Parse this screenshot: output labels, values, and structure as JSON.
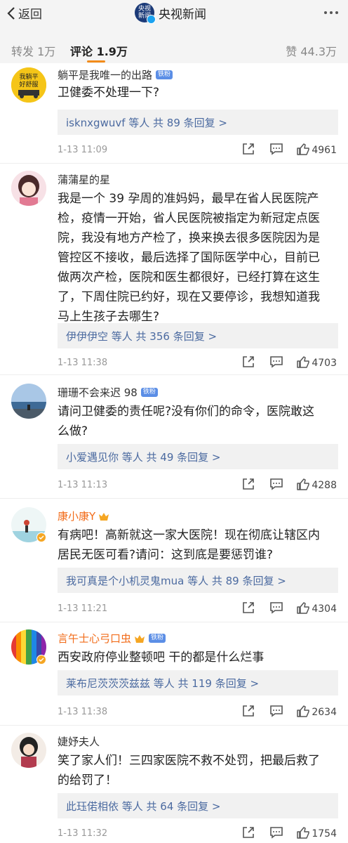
{
  "nav": {
    "back_label": "返回",
    "logo_line1": "央视",
    "logo_line2": "新闻",
    "title": "央视新闻"
  },
  "tabs": {
    "repost": "转发 1万",
    "comments": "评论 1.9万",
    "likes": "赞 44.3万"
  },
  "comments": [
    {
      "name": "躺平是我唯一的出路",
      "badge": "铁粉",
      "text": [
        "卫健委不处理一下?"
      ],
      "reply": "isknxgwuvf 等人  共 89 条回复 >",
      "time": "1-13 11:09",
      "likes": "4961"
    },
    {
      "name": "蒲蒲星的星",
      "badge": "",
      "text": [
        "我是一个 39 孕周的准妈妈，最早在省人民医院产",
        "检，疫情一开始，省人民医院被指定为新冠定点医",
        "院，我没有地方产检了，换来换去很多医院因为是",
        "管控区不接收，最后选择了国际医学中心，目前已",
        "做两次产检，医院和医生都很好，已经打算在这生",
        "了，下周住院已约好，现在又要停诊，我想知道我",
        "马上生孩子去哪生?"
      ],
      "reply": "伊伊伊空 等人  共 356 条回复 >",
      "time": "1-13 11:38",
      "likes": "4703"
    },
    {
      "name": "珊珊不会来迟 98",
      "badge": "铁粉",
      "text": [
        "请问卫健委的责任呢?没有你们的命令，医院敢这",
        "么做?"
      ],
      "reply": "小爱遇见你 等人  共 49 条回复 >",
      "time": "1-13 11:13",
      "likes": "4288"
    },
    {
      "name": "康小康Y",
      "badge": "",
      "text": [
        "有病吧！高新就这一家大医院！现在彻底让辖区内",
        "居民无医可看?请问：这到底是要惩罚谁?"
      ],
      "reply": "我可真是个小机灵鬼mua 等人  共 89 条回复 >",
      "time": "1-13 11:21",
      "likes": "4304"
    },
    {
      "name": "言午士心弓口虫",
      "badge": "铁粉",
      "text": [
        "西安政府停业整顿吧  干的都是什么烂事"
      ],
      "reply": "莱布尼茨茨茨兹兹 等人  共 119 条回复 >",
      "time": "1-13 11:38",
      "likes": "2634"
    },
    {
      "name": "婕妤夫人",
      "badge": "",
      "text": [
        "笑了家人们！三四家医院不救不处罚，把最后救了",
        "的给罚了！"
      ],
      "reply": "此珏偌相依 等人  共 64 条回复 >",
      "time": "1-13 11:32",
      "likes": "1754"
    }
  ],
  "avatar0_text": [
    "我躺平",
    "好舒服"
  ],
  "colors": {
    "accent": "#f28b1a",
    "link": "#4b6aa0",
    "badge": "#5b8ee6",
    "orange_name": "#f26c1a"
  }
}
